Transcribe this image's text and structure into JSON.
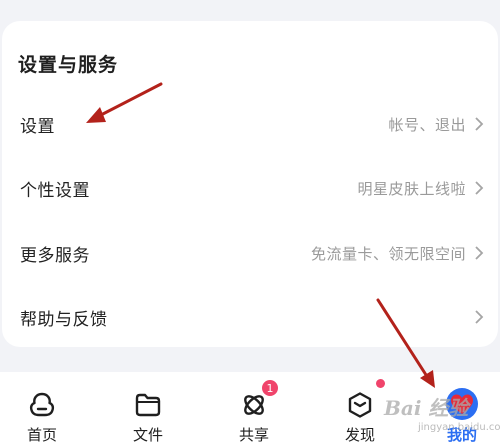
{
  "settings_section": {
    "title": "设置与服务",
    "rows": [
      {
        "label": "设置",
        "value": "帐号、退出"
      },
      {
        "label": "个性设置",
        "value": "明星皮肤上线啦"
      },
      {
        "label": "更多服务",
        "value": "免流量卡、领无限空间"
      },
      {
        "label": "帮助与反馈",
        "value": ""
      }
    ]
  },
  "tabbar": {
    "tabs": [
      {
        "label": "首页",
        "icon": "home-icon"
      },
      {
        "label": "文件",
        "icon": "folder-icon"
      },
      {
        "label": "共享",
        "icon": "share-icon",
        "badge": "1"
      },
      {
        "label": "发现",
        "icon": "discover-icon"
      },
      {
        "label": "我的",
        "icon": "avatar",
        "active": true
      }
    ]
  },
  "watermark": {
    "text": "Bai 经验",
    "sub": "jingyan.baidu.com"
  },
  "colors": {
    "accent": "#2b6ef2",
    "badge": "#f0446b",
    "arrow": "#b3221b",
    "background": "#f2f3f7"
  }
}
